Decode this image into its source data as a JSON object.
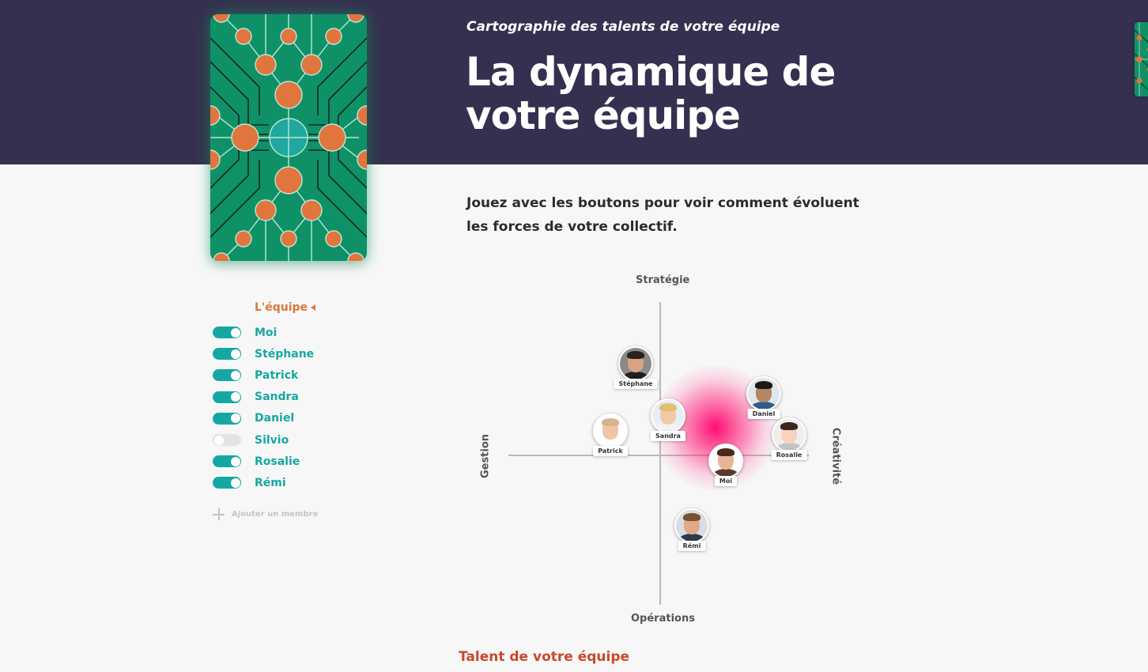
{
  "header": {
    "subtitle": "Cartographie des talents de votre équipe",
    "title_line1": "La dynamique de",
    "title_line2": "votre équipe",
    "background_color": "#35304f"
  },
  "intro": {
    "text": "Jouez avec les boutons pour voir comment évoluent les forces de votre collectif."
  },
  "team": {
    "heading": "L'équipe",
    "members": [
      {
        "name": "Moi",
        "active": true
      },
      {
        "name": "Stéphane",
        "active": true
      },
      {
        "name": "Patrick",
        "active": true
      },
      {
        "name": "Sandra",
        "active": true
      },
      {
        "name": "Daniel",
        "active": true
      },
      {
        "name": "Silvio",
        "active": false
      },
      {
        "name": "Rosalie",
        "active": true
      },
      {
        "name": "Rémi",
        "active": true
      }
    ],
    "add_member_label": "Ajouter un membre"
  },
  "map": {
    "axes": {
      "top": "Stratégie",
      "bottom": "Opérations",
      "left": "Gestion",
      "right": "Créativité"
    },
    "people": [
      {
        "name": "Stéphane",
        "skin": "#d9a383",
        "hair": "#2b2220",
        "shirt": "#1f1f1f",
        "bg": "#8a8a8a"
      },
      {
        "name": "Daniel",
        "skin": "#b58564",
        "hair": "#1d1715",
        "shirt": "#2f5e8c",
        "bg": "#dfe6ee"
      },
      {
        "name": "Sandra",
        "skin": "#f1c9a8",
        "hair": "#e2c070",
        "shirt": "#f3f3f3",
        "bg": "#e8eef5"
      },
      {
        "name": "Patrick",
        "skin": "#f0c4a6",
        "hair": "#d7b48e",
        "shirt": "#ffffff",
        "bg": "#ffffff"
      },
      {
        "name": "Rosalie",
        "skin": "#f5d3bd",
        "hair": "#3a2620",
        "shirt": "#c4c4c4",
        "bg": "#eeeeee"
      },
      {
        "name": "Moi",
        "skin": "#e7b495",
        "hair": "#4a2a1e",
        "shirt": "#5a3a2a",
        "bg": "#ffffff"
      },
      {
        "name": "Rémi",
        "skin": "#e2a888",
        "hair": "#7a5030",
        "shirt": "#2c3b4f",
        "bg": "#d8dde4"
      }
    ],
    "glow_color": "#ff0a6e"
  },
  "talent": {
    "heading": "Talent de votre équipe"
  },
  "colors": {
    "accent_teal": "#17a7a2",
    "accent_orange": "#d9783a",
    "card_green": "#0f9168",
    "card_orange": "#e0763e",
    "talent_red": "#c9482b"
  }
}
